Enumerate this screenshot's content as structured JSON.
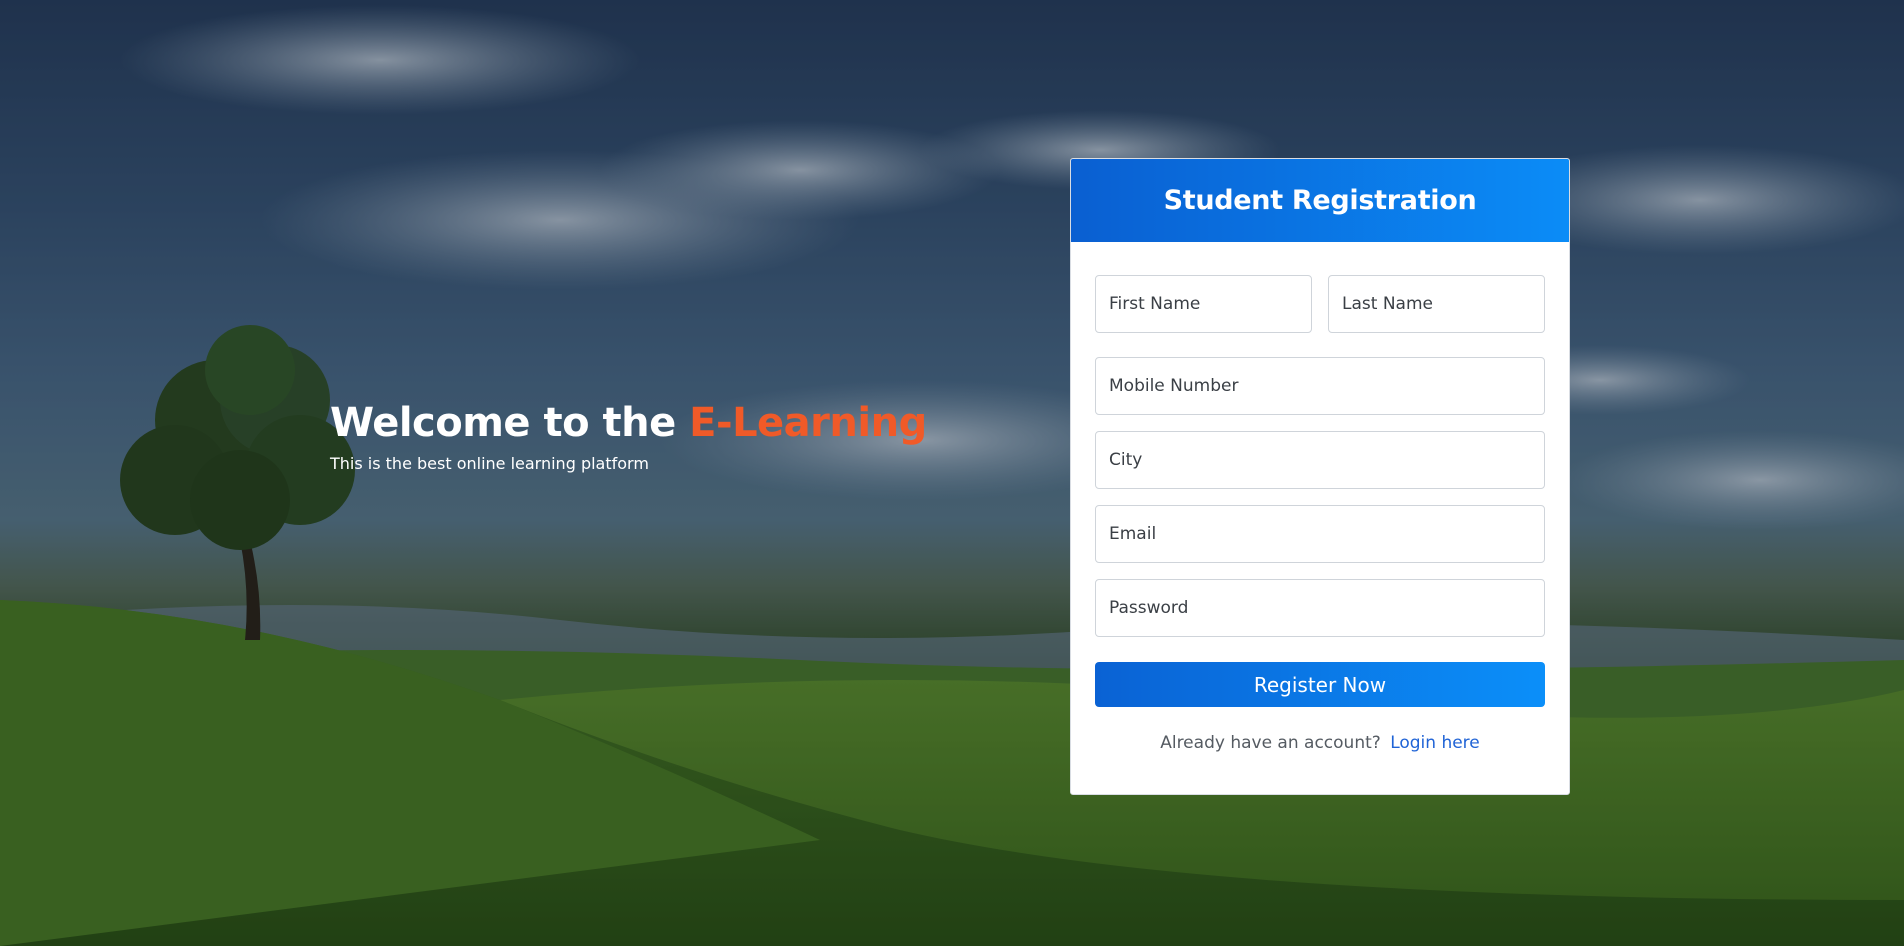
{
  "hero": {
    "title_prefix": "Welcome to the ",
    "title_accent": "E-Learning",
    "subtitle": "This is the best online learning platform"
  },
  "form": {
    "title": "Student Registration",
    "fields": {
      "first_name_placeholder": "First Name",
      "last_name_placeholder": "Last Name",
      "mobile_placeholder": "Mobile Number",
      "city_placeholder": "City",
      "email_placeholder": "Email",
      "password_placeholder": "Password"
    },
    "submit_label": "Register Now",
    "login_prompt": "Already have an account?",
    "login_link": "Login here"
  },
  "colors": {
    "accent_orange": "#f05a28",
    "primary_blue": "#0a62d4",
    "primary_blue_light": "#0b8ff9",
    "link_blue": "#1f63d6"
  }
}
